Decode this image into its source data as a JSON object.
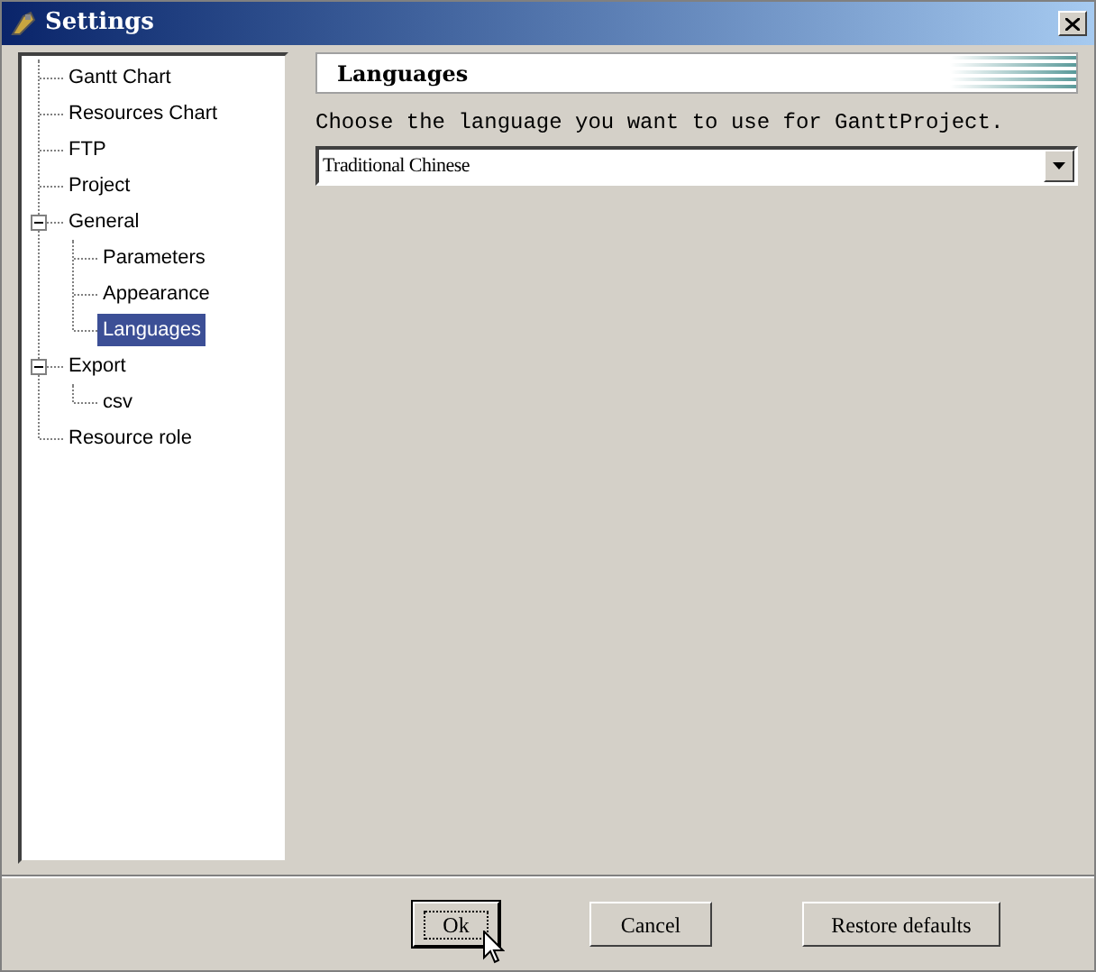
{
  "window": {
    "title": "Settings"
  },
  "tree": [
    {
      "label": "Gantt Chart",
      "selected": false
    },
    {
      "label": "Resources Chart",
      "selected": false
    },
    {
      "label": "FTP",
      "selected": false
    },
    {
      "label": "Project",
      "selected": false
    },
    {
      "label": "General",
      "selected": false,
      "expanded": true,
      "children": [
        {
          "label": "Parameters",
          "selected": false
        },
        {
          "label": "Appearance",
          "selected": false
        },
        {
          "label": "Languages",
          "selected": true
        }
      ]
    },
    {
      "label": "Export",
      "selected": false,
      "expanded": true,
      "children": [
        {
          "label": "csv",
          "selected": false
        }
      ]
    },
    {
      "label": "Resource role",
      "selected": false
    }
  ],
  "panel": {
    "title": "Languages",
    "prompt": "Choose the language you want to use for GanttProject.",
    "language_select": {
      "value": "Traditional Chinese"
    }
  },
  "buttons": [
    {
      "label": "Ok",
      "focused": true
    },
    {
      "label": "Cancel",
      "focused": false
    },
    {
      "label": "Restore defaults",
      "focused": false
    }
  ]
}
